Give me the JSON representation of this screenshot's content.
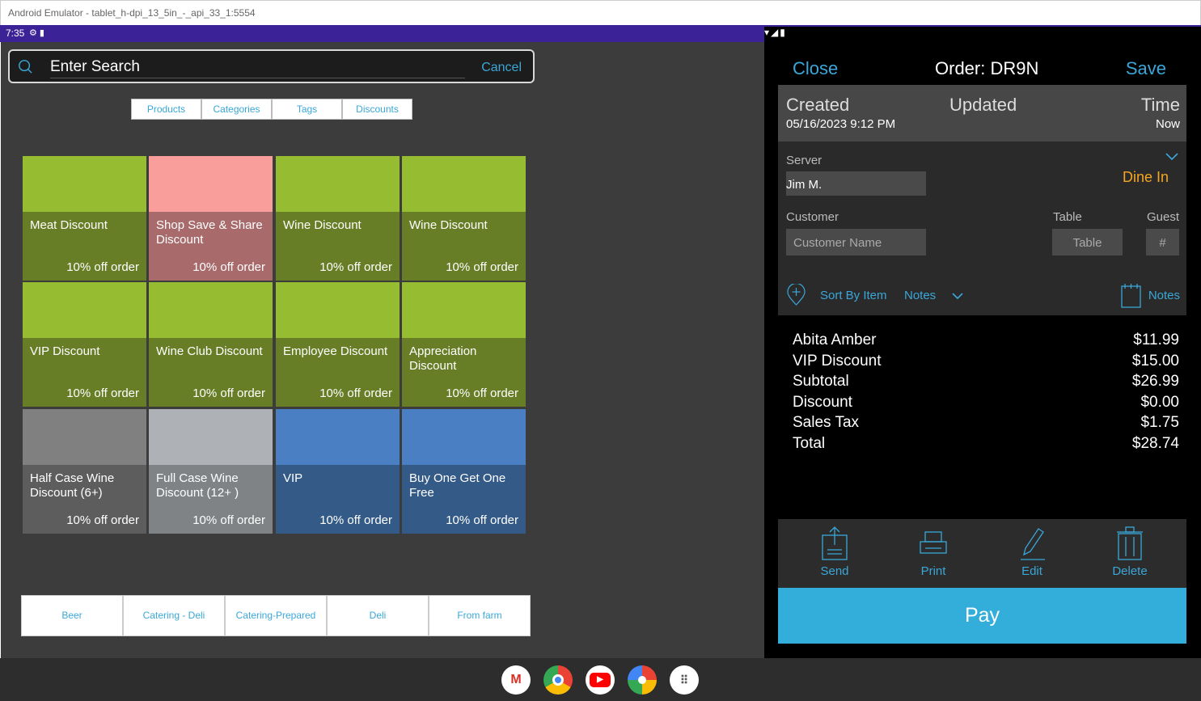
{
  "window": {
    "title": "Android Emulator - tablet_h-dpi_13_5in_-_api_33_1:5554"
  },
  "status": {
    "time": "7:35",
    "icons": "⚙ ▮",
    "right": "▾◢▮"
  },
  "search": {
    "placeholder": "Enter Search",
    "cancel": "Cancel"
  },
  "tabs": [
    "Products",
    "Categories",
    "Tags",
    "Discounts"
  ],
  "tiles": [
    {
      "name": "Meat Discount",
      "sub": "10% off order",
      "color": "green"
    },
    {
      "name": "Shop Save & Share Discount",
      "sub": "10% off order",
      "color": "pink"
    },
    {
      "name": "Wine Discount",
      "sub": "10% off order",
      "color": "green"
    },
    {
      "name": "Wine Discount",
      "sub": "10% off order",
      "color": "green"
    },
    {
      "name": "VIP Discount",
      "sub": "10% off order",
      "color": "green"
    },
    {
      "name": "Wine Club Discount",
      "sub": "10% off order",
      "color": "green"
    },
    {
      "name": "Employee Discount",
      "sub": "10% off order",
      "color": "green"
    },
    {
      "name": "Appreciation Discount",
      "sub": "10% off order",
      "color": "green"
    },
    {
      "name": "Half Case Wine Discount (6+)",
      "sub": "10% off order",
      "color": "gray1"
    },
    {
      "name": "Full Case Wine Discount (12+ )",
      "sub": "10% off order",
      "color": "gray2"
    },
    {
      "name": "VIP",
      "sub": "10% off order",
      "color": "blue"
    },
    {
      "name": "Buy One Get One Free",
      "sub": "10% off order",
      "color": "blue"
    }
  ],
  "categories": [
    "Beer",
    "Catering - Deli",
    "Catering-Prepared",
    "Deli",
    "From farm"
  ],
  "order": {
    "close": "Close",
    "title": "Order: DR9N",
    "save": "Save",
    "created_label": "Created",
    "created_value": "05/16/2023 9:12 PM",
    "updated_label": "Updated",
    "time_label": "Time",
    "time_value": "Now",
    "server_label": "Server",
    "server_value": "Jim M.",
    "dine": "Dine In",
    "customer_label": "Customer",
    "customer_placeholder": "Customer Name",
    "table_label": "Table",
    "table_placeholder": "Table",
    "guest_label": "Guest",
    "guest_placeholder": "#",
    "sort": "Sort By Item",
    "notes_dropdown": "Notes",
    "notes": "Notes",
    "lines": [
      {
        "label": "Abita Amber",
        "value": "$11.99"
      },
      {
        "label": "VIP Discount",
        "value": "$15.00"
      },
      {
        "label": "Subtotal",
        "value": "$26.99"
      },
      {
        "label": "Discount",
        "value": "$0.00"
      },
      {
        "label": "Sales Tax",
        "value": "$1.75"
      },
      {
        "label": "Total",
        "value": "$28.74"
      }
    ],
    "actions": {
      "send": "Send",
      "print": "Print",
      "edit": "Edit",
      "delete": "Delete"
    },
    "pay": "Pay"
  },
  "dock": [
    "gmail",
    "chrome",
    "youtube",
    "photos",
    "app-drawer"
  ]
}
